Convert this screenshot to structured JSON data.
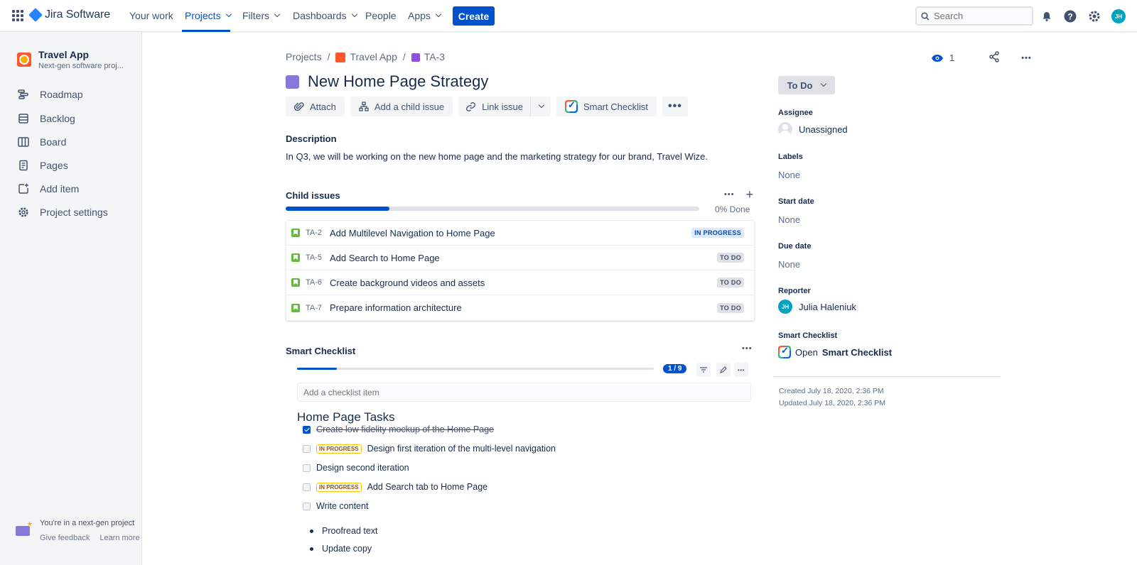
{
  "colors": {
    "brand": "#0052cc",
    "accent": "#2684ff",
    "epic": "#8777d9",
    "story": "#63ba3c"
  },
  "topnav": {
    "logo": "Jira Software",
    "items": [
      {
        "label": "Your work"
      },
      {
        "label": "Projects"
      },
      {
        "label": "Filters"
      },
      {
        "label": "Dashboards"
      },
      {
        "label": "People"
      },
      {
        "label": "Apps"
      }
    ],
    "create_label": "Create",
    "search_placeholder": "Search",
    "avatar_initials": "JH",
    "icons": [
      "apps-grid-icon",
      "notification-icon",
      "help-icon",
      "settings-icon"
    ]
  },
  "sidebar": {
    "project_name": "Travel App",
    "project_type": "Next-gen software proj...",
    "items": [
      {
        "label": "Roadmap",
        "icon": "roadmap-icon"
      },
      {
        "label": "Backlog",
        "icon": "backlog-icon"
      },
      {
        "label": "Board",
        "icon": "board-icon"
      },
      {
        "label": "Pages",
        "icon": "pages-icon"
      },
      {
        "label": "Add item",
        "icon": "add-item-icon"
      },
      {
        "label": "Project settings",
        "icon": "settings-icon"
      }
    ],
    "footer_title": "You're in a next-gen project",
    "footer_feedback": "Give feedback",
    "footer_learn": "Learn more"
  },
  "breadcrumb": {
    "projects": "Projects",
    "project": "Travel App",
    "issue_key": "TA-3"
  },
  "issue": {
    "title": "New Home Page Strategy",
    "toolbar": {
      "attach": "Attach",
      "add_child": "Add a child issue",
      "link_issue": "Link issue",
      "smart_checklist": "Smart Checklist"
    },
    "description_label": "Description",
    "description": "In Q3, we will be working on the new home page and the marketing strategy for our brand, Travel Wize.",
    "child_issues": {
      "label": "Child issues",
      "done_text": "0% Done",
      "progress_fraction": 0.25,
      "items": [
        {
          "key": "TA-2",
          "summary": "Add Multilevel Navigation to Home Page",
          "status": "IN PROGRESS"
        },
        {
          "key": "TA-5",
          "summary": "Add Search to Home Page",
          "status": "TO DO"
        },
        {
          "key": "TA-6",
          "summary": "Create background videos and assets",
          "status": "TO DO"
        },
        {
          "key": "TA-7",
          "summary": "Prepare information architecture",
          "status": "TO DO"
        }
      ]
    },
    "smart_checklist": {
      "label": "Smart Checklist",
      "counter": "1 / 9",
      "progress_fraction": 0.111,
      "add_placeholder": "Add a checklist item",
      "heading": "Home Page Tasks",
      "items": [
        {
          "text": "Create low fidelity mockup of the Home Page",
          "checked": true,
          "badge": ""
        },
        {
          "text": "Design first iteration of the multi-level navigation",
          "checked": false,
          "badge": "IN PROGRESS"
        },
        {
          "text": "Design second iteration",
          "checked": false,
          "badge": ""
        },
        {
          "text": "Add Search tab to Home Page",
          "checked": false,
          "badge": "IN PROGRESS"
        },
        {
          "text": "Write content",
          "checked": false,
          "badge": ""
        }
      ],
      "bullets": [
        "Proofread text",
        "Update copy"
      ]
    }
  },
  "details": {
    "watchers": "1",
    "status": "To Do",
    "assignee_label": "Assignee",
    "assignee": "Unassigned",
    "labels_label": "Labels",
    "labels": "None",
    "start_label": "Start date",
    "start": "None",
    "due_label": "Due date",
    "due": "None",
    "reporter_label": "Reporter",
    "reporter": "Julia Haleniuk",
    "reporter_initials": "JH",
    "sc_label": "Smart Checklist",
    "sc_open": "Open",
    "sc_open_bold": "Smart Checklist",
    "created": "Created July 18, 2020, 2:36 PM",
    "updated": "Updated July 18, 2020, 2:36 PM"
  }
}
